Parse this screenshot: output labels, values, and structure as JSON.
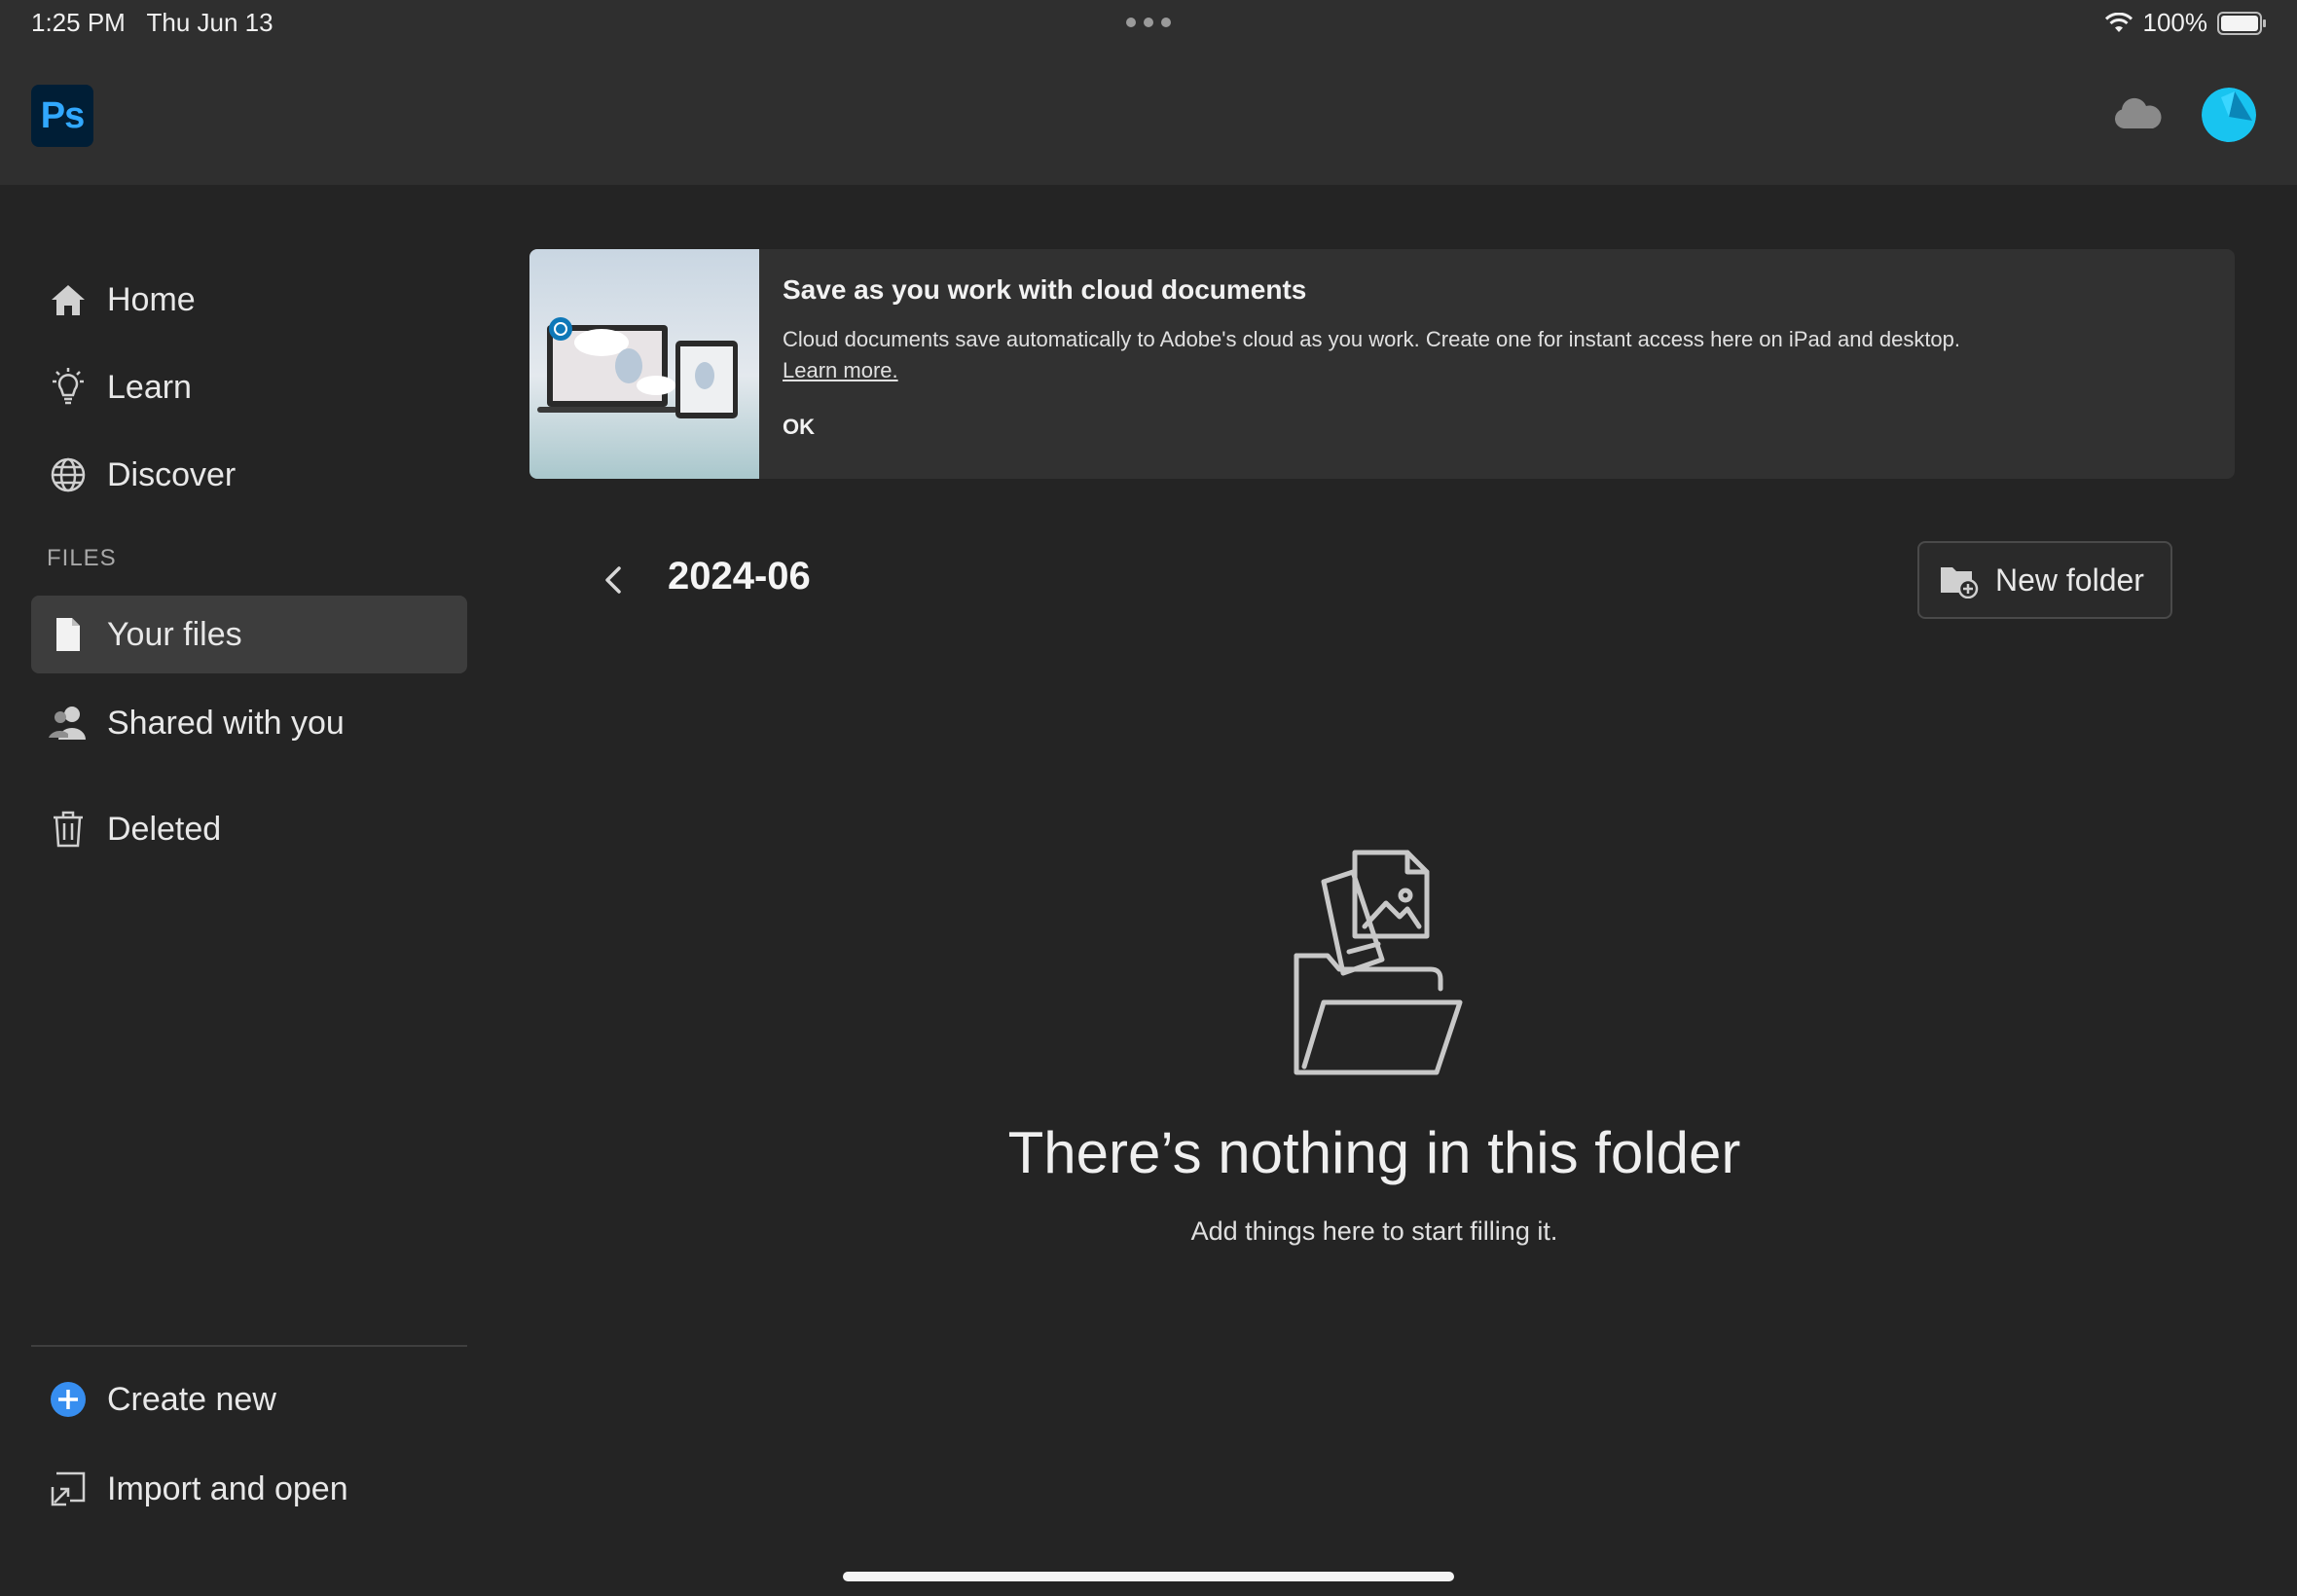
{
  "status_bar": {
    "time": "1:25 PM",
    "date": "Thu Jun 13",
    "battery": "100%",
    "icons": [
      "wifi-icon",
      "battery-icon"
    ]
  },
  "app": {
    "logo_text": "Ps",
    "brand_color": "#31a8ff",
    "logo_bg": "#001e36",
    "header_icons": [
      "cloud-icon",
      "avatar"
    ]
  },
  "sidebar": {
    "nav": [
      {
        "label": "Home",
        "icon": "home-icon"
      },
      {
        "label": "Learn",
        "icon": "lightbulb-icon"
      },
      {
        "label": "Discover",
        "icon": "globe-icon"
      }
    ],
    "files_heading": "FILES",
    "files": [
      {
        "label": "Your files",
        "icon": "document-icon",
        "active": true
      },
      {
        "label": "Shared with you",
        "icon": "people-icon",
        "active": false
      },
      {
        "label": "Deleted",
        "icon": "trash-icon",
        "active": false
      }
    ],
    "actions": [
      {
        "label": "Create new",
        "icon": "plus-circle-icon",
        "accent": "#378ef0"
      },
      {
        "label": "Import and open",
        "icon": "import-icon"
      }
    ]
  },
  "banner": {
    "title": "Save as you work with cloud documents",
    "body": "Cloud documents save automatically to Adobe's cloud as you work. Create one for instant access here on iPad and desktop.",
    "link": "Learn more.",
    "ok": "OK"
  },
  "folder": {
    "title": "2024-06",
    "new_folder_label": "New folder"
  },
  "empty_state": {
    "title": "There’s nothing in this folder",
    "subtitle": "Add things here to start filling it."
  }
}
